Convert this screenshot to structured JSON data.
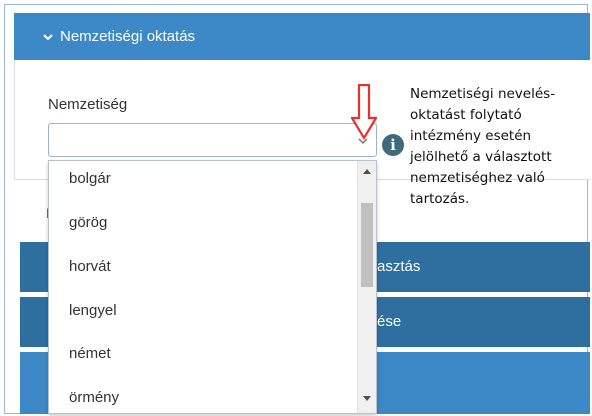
{
  "section": {
    "title": "Nemzetiségi oktatás"
  },
  "field": {
    "label": "Nemzetiség",
    "value": ""
  },
  "info": {
    "text": "Nemzetiségi nevelés-oktatást folytató intézmény esetén jelölhető a választott nemzetiséghez való tartozás."
  },
  "dropdown": {
    "options": [
      "bolgár",
      "görög",
      "horvát",
      "lengyel",
      "német",
      "örmény"
    ]
  },
  "hidden_sections": {
    "bar1_partial": "asztás",
    "bar2_partial": "ése",
    "left_partial": "I"
  },
  "colors": {
    "header_blue": "#3d89c8",
    "bar_dark": "#2f6f9f",
    "arrow_red": "#e8312b",
    "info_icon": "#3e6a7c"
  },
  "icons": [
    "chevron-down-icon",
    "caret-down-icon",
    "red-down-arrow-icon",
    "info-icon",
    "scroll-up-icon",
    "scroll-down-icon"
  ]
}
